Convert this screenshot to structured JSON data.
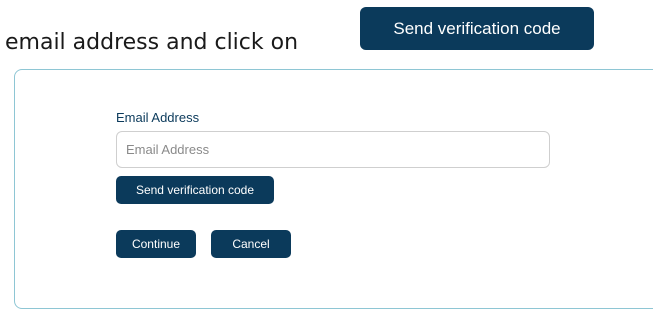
{
  "instruction": {
    "text": "email address and click on",
    "button_label": "Send verification code"
  },
  "form": {
    "email_label": "Email Address",
    "email_placeholder": "Email Address",
    "email_value": "",
    "send_code_label": "Send verification code",
    "continue_label": "Continue",
    "cancel_label": "Cancel"
  },
  "colors": {
    "primary": "#0b3a5b",
    "panel_border": "#8ec6d4",
    "input_border": "#cfcfcf"
  }
}
